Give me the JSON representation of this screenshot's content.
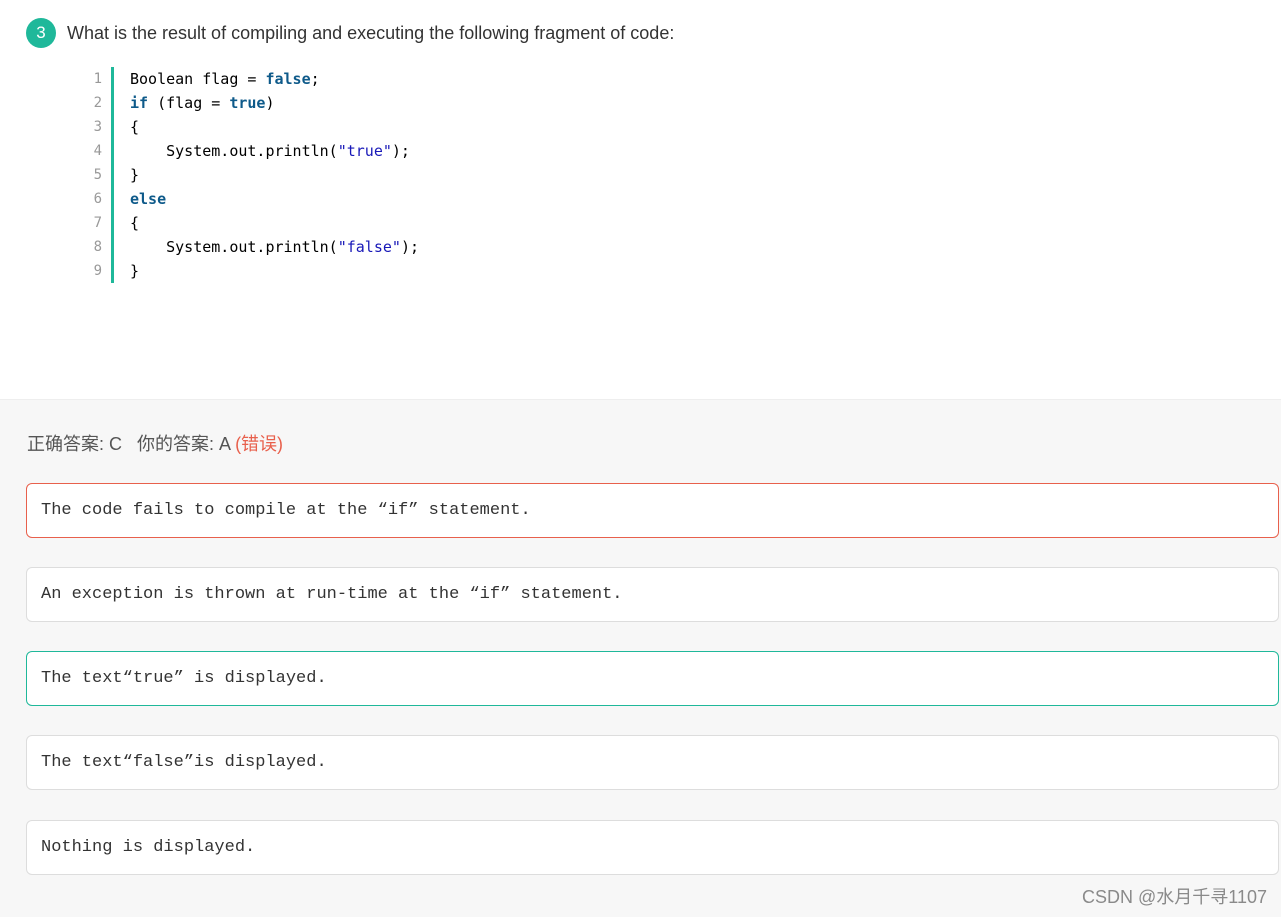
{
  "question": {
    "number": "3",
    "text": "What is the result of compiling and executing the following fragment of code:"
  },
  "code": {
    "line_numbers": [
      "1",
      "2",
      "3",
      "4",
      "5",
      "6",
      "7",
      "8",
      "9"
    ],
    "lines": [
      [
        {
          "t": "Boolean flag = ",
          "c": "plain"
        },
        {
          "t": "false",
          "c": "kw"
        },
        {
          "t": ";",
          "c": "plain"
        }
      ],
      [
        {
          "t": "if",
          "c": "kw"
        },
        {
          "t": " (flag = ",
          "c": "plain"
        },
        {
          "t": "true",
          "c": "kw"
        },
        {
          "t": ")",
          "c": "plain"
        }
      ],
      [
        {
          "t": "{",
          "c": "plain"
        }
      ],
      [
        {
          "t": "    System.out.println(",
          "c": "plain"
        },
        {
          "t": "\"true\"",
          "c": "str"
        },
        {
          "t": ");",
          "c": "plain"
        }
      ],
      [
        {
          "t": "}",
          "c": "plain"
        }
      ],
      [
        {
          "t": "else",
          "c": "kw"
        }
      ],
      [
        {
          "t": "{",
          "c": "plain"
        }
      ],
      [
        {
          "t": "    System.out.println(",
          "c": "plain"
        },
        {
          "t": "\"false\"",
          "c": "str"
        },
        {
          "t": ");",
          "c": "plain"
        }
      ],
      [
        {
          "t": "}",
          "c": "plain"
        }
      ]
    ]
  },
  "result": {
    "correct_label": "正确答案: C",
    "your_label": "你的答案: A",
    "status": "(错误)"
  },
  "options": [
    {
      "text": "The code fails to compile at the “if” statement.",
      "state": "wrong"
    },
    {
      "text": "An exception is thrown at run-time at the “if” statement.",
      "state": "normal"
    },
    {
      "text": "The text“true” is displayed.",
      "state": "correct"
    },
    {
      "text": "The text“false”is displayed.",
      "state": "normal"
    },
    {
      "text": "Nothing is displayed.",
      "state": "normal"
    }
  ],
  "colors": {
    "accent": "#1fb89a",
    "error": "#e8604c",
    "keyword": "#0e5a8a",
    "string": "#1818b8"
  },
  "watermark": "CSDN @水月千寻1107"
}
